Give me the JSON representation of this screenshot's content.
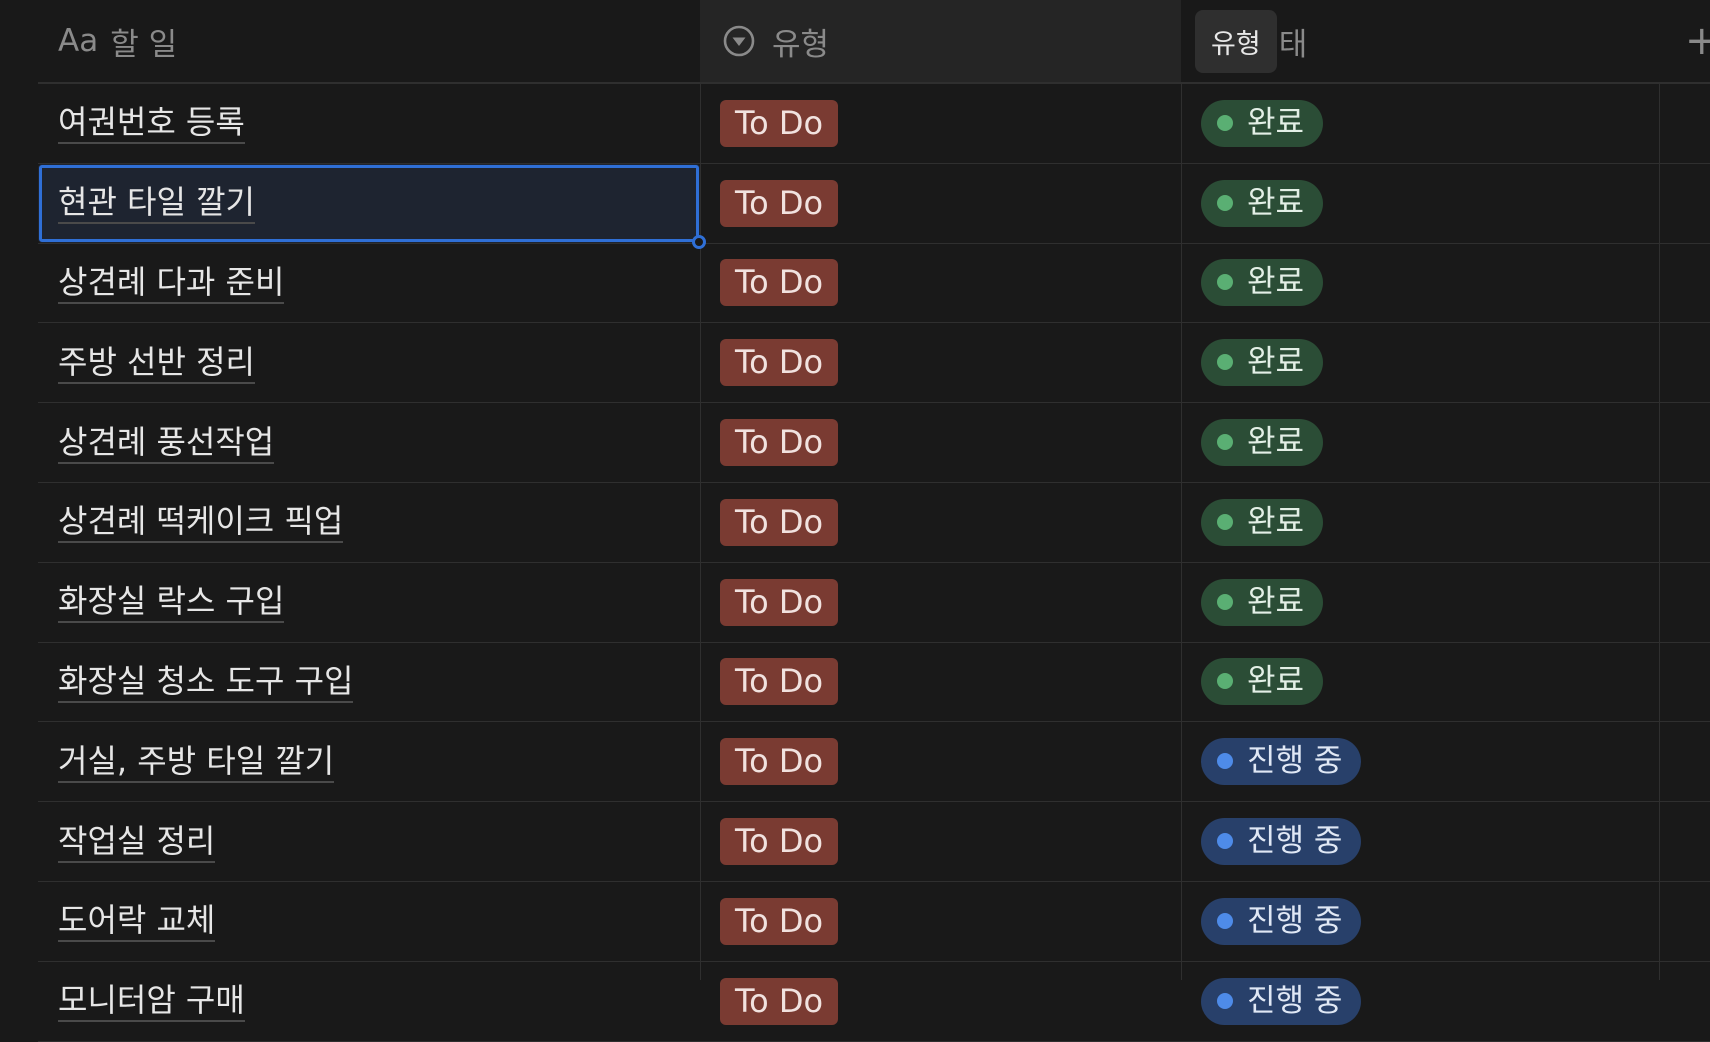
{
  "header": {
    "name_col_glyph": "Aa",
    "name_col_label": "할 일",
    "type_col_label": "유형",
    "status_tooltip": "유형",
    "status_col_label_visible": "태",
    "add_column_glyph": "+"
  },
  "colors": {
    "background": "#191919",
    "todo_tag": "#7a3b32",
    "done_tag": "#2b4d36",
    "done_dot": "#5aaf73",
    "progress_tag": "#28406a",
    "progress_dot": "#4e8be8",
    "selection": "#2f6fd6"
  },
  "rows": [
    {
      "name": "여권번호 등록",
      "type": "To Do",
      "status": "완료",
      "status_kind": "done"
    },
    {
      "name": "현관 타일 깔기",
      "type": "To Do",
      "status": "완료",
      "status_kind": "done",
      "selected": true
    },
    {
      "name": "상견례 다과 준비",
      "type": "To Do",
      "status": "완료",
      "status_kind": "done"
    },
    {
      "name": "주방 선반 정리",
      "type": "To Do",
      "status": "완료",
      "status_kind": "done"
    },
    {
      "name": "상견례 풍선작업",
      "type": "To Do",
      "status": "완료",
      "status_kind": "done"
    },
    {
      "name": "상견례 떡케이크 픽업",
      "type": "To Do",
      "status": "완료",
      "status_kind": "done"
    },
    {
      "name": "화장실 락스 구입",
      "type": "To Do",
      "status": "완료",
      "status_kind": "done"
    },
    {
      "name": "화장실 청소 도구 구입",
      "type": "To Do",
      "status": "완료",
      "status_kind": "done"
    },
    {
      "name": "거실, 주방 타일 깔기",
      "type": "To Do",
      "status": "진행 중",
      "status_kind": "progress"
    },
    {
      "name": "작업실 정리",
      "type": "To Do",
      "status": "진행 중",
      "status_kind": "progress"
    },
    {
      "name": "도어락 교체",
      "type": "To Do",
      "status": "진행 중",
      "status_kind": "progress"
    },
    {
      "name": "모니터암 구매",
      "type": "To Do",
      "status": "진행 중",
      "status_kind": "progress"
    }
  ]
}
